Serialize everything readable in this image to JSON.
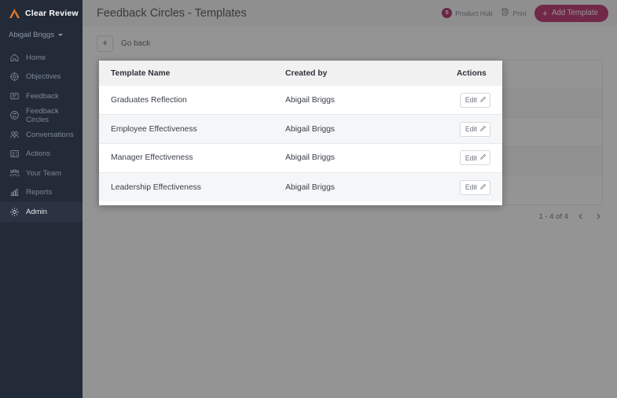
{
  "brand": {
    "name": "Clear Review",
    "logo_icon": "chevron-logo-icon",
    "logo_color": "#e8822a"
  },
  "sidebar": {
    "user": {
      "name": "Abigail Briggs",
      "caret_icon": "chevron-down-icon"
    },
    "items": [
      {
        "label": "Home",
        "icon": "home-icon",
        "active": false
      },
      {
        "label": "Objectives",
        "icon": "target-icon",
        "active": false
      },
      {
        "label": "Feedback",
        "icon": "comment-icon",
        "active": false
      },
      {
        "label": "Feedback Circles",
        "icon": "circle-arrows-icon",
        "active": false
      },
      {
        "label": "Conversations",
        "icon": "people-icon",
        "active": false
      },
      {
        "label": "Actions",
        "icon": "checklist-icon",
        "active": false
      },
      {
        "label": "Your Team",
        "icon": "team-icon",
        "active": false
      },
      {
        "label": "Reports",
        "icon": "bar-chart-icon",
        "active": false
      },
      {
        "label": "Admin",
        "icon": "gear-icon",
        "active": true
      }
    ],
    "background": "#232b38",
    "active_background": "#2b3342"
  },
  "header": {
    "title": "Feedback Circles - Templates",
    "product_hub": {
      "label": "Product Hub",
      "badge_count": "5",
      "badge_color": "#a51050"
    },
    "print": {
      "label": "Print",
      "icon": "printer-icon"
    },
    "add_template": {
      "label": "Add Template",
      "icon": "plus-icon",
      "color": "#b3105a"
    }
  },
  "background_page": {
    "go_back": {
      "label": "Go back",
      "icon": "arrow-left-icon"
    },
    "row_count": 5,
    "pagination": {
      "range": "1 - 4 of 4",
      "prev_icon": "chevron-left-icon",
      "next_icon": "chevron-right-icon"
    }
  },
  "modal": {
    "columns": [
      "Template Name",
      "Created by",
      "Actions"
    ],
    "rows": [
      {
        "name": "Graduates Reflection",
        "created_by": "Abigail Briggs",
        "action_label": "Edit",
        "action_icon": "pencil-icon"
      },
      {
        "name": "Employee Effectiveness",
        "created_by": "Abigail Briggs",
        "action_label": "Edit",
        "action_icon": "pencil-icon"
      },
      {
        "name": "Manager Effectiveness",
        "created_by": "Abigail Briggs",
        "action_label": "Edit",
        "action_icon": "pencil-icon"
      },
      {
        "name": "Leadership Effectiveness",
        "created_by": "Abigail Briggs",
        "action_label": "Edit",
        "action_icon": "pencil-icon"
      }
    ]
  }
}
